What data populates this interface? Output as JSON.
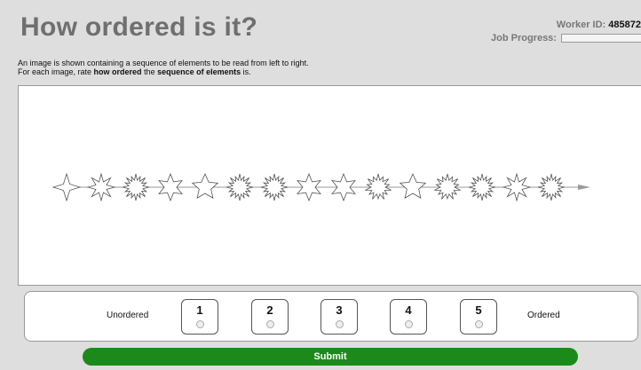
{
  "header": {
    "title": "How ordered is it?",
    "worker_label": "Worker ID:",
    "worker_id": "485872",
    "progress_label": "Job Progress:",
    "progress_fraction": 0.0
  },
  "instructions": {
    "line1": "An image is shown containing a sequence of elements to be read from left to right.",
    "line2_prefix": "For each image, rate ",
    "line2_bold1": "how ordered",
    "line2_mid": " the ",
    "line2_bold2": "sequence of elements",
    "line2_suffix": " is."
  },
  "sequence": {
    "elements": [
      {
        "icon": "star-4-point-icon",
        "points": 4
      },
      {
        "icon": "star-8-point-icon",
        "points": 8
      },
      {
        "icon": "star-burst-icon",
        "points": 16
      },
      {
        "icon": "star-6-point-icon",
        "points": 6
      },
      {
        "icon": "star-5-point-icon",
        "points": 5
      },
      {
        "icon": "star-burst-icon",
        "points": 16
      },
      {
        "icon": "star-burst-icon",
        "points": 16
      },
      {
        "icon": "star-6-point-icon",
        "points": 6
      },
      {
        "icon": "star-6-point-icon",
        "points": 6
      },
      {
        "icon": "star-burst-icon",
        "points": 14
      },
      {
        "icon": "star-5-point-icon",
        "points": 5
      },
      {
        "icon": "star-burst-icon",
        "points": 14
      },
      {
        "icon": "star-burst-icon",
        "points": 16
      },
      {
        "icon": "star-8-point-icon",
        "points": 8
      },
      {
        "icon": "star-burst-icon",
        "points": 16
      }
    ],
    "arrow_icon": "arrow-right-icon"
  },
  "rating": {
    "left_label": "Unordered",
    "right_label": "Ordered",
    "options": [
      "1",
      "2",
      "3",
      "4",
      "5"
    ]
  },
  "submit_label": "Submit",
  "colors": {
    "background": "#dedede",
    "title": "#6f6f6f",
    "submit": "#1b8a1b"
  }
}
